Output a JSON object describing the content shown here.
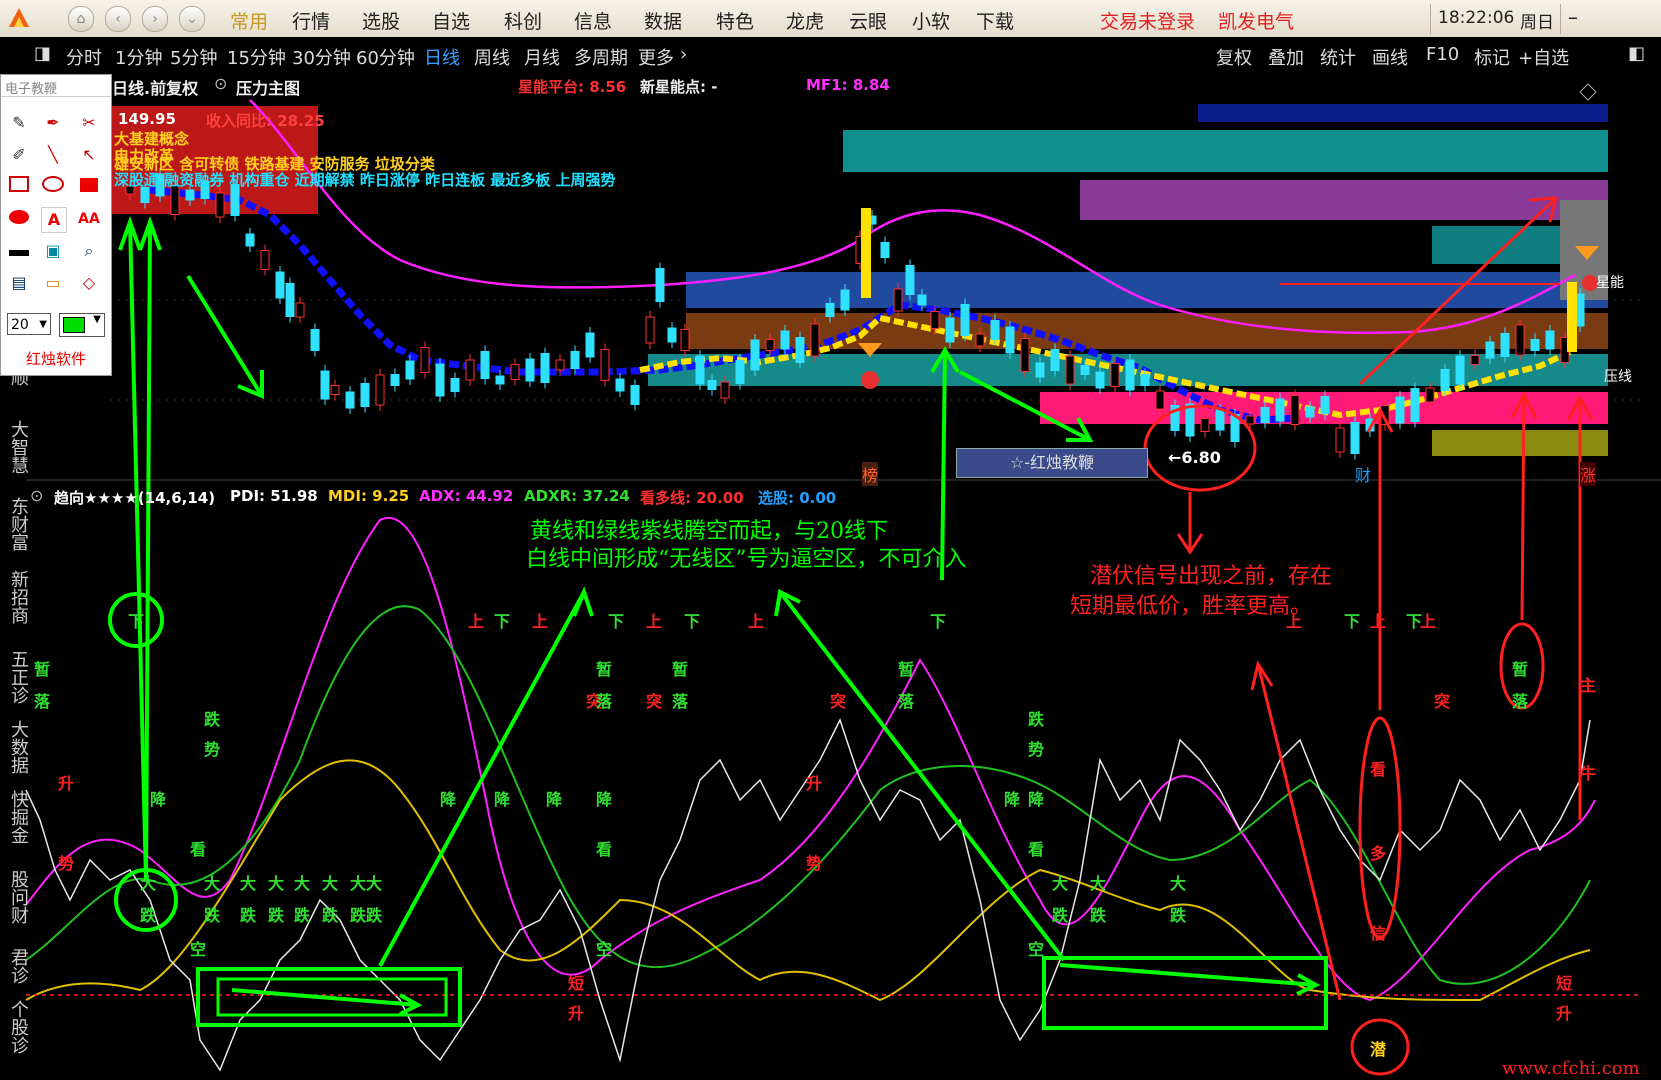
{
  "menu": {
    "items": [
      "常用",
      "行情",
      "选股",
      "自选",
      "科创",
      "信息",
      "数据",
      "特色",
      "龙虎",
      "云眼",
      "小软",
      "下载"
    ],
    "login": "交易未登录",
    "stock": "凯发电气",
    "time": "18:22:06",
    "weekday": "周日"
  },
  "periods": {
    "items": [
      "分时",
      "1分钟",
      "5分钟",
      "15分钟",
      "30分钟",
      "60分钟",
      "日线",
      "周线",
      "月线",
      "多周期",
      "更多"
    ],
    "active": "日线",
    "right": [
      "复权",
      "叠加",
      "统计",
      "画线",
      "F10",
      "标记",
      "+自选"
    ]
  },
  "chart_header": {
    "title": "日线.前复权",
    "main_fig": "压力主图",
    "star_platform_label": "星能平台: 8.56",
    "new_star_label": "新星能点: -",
    "mf1_label": "MF1: 8.84"
  },
  "overlay": {
    "price_top": "149.95",
    "revenue_yoy": "收入同比: 28.25",
    "concepts_1": "大基建概念",
    "concepts_2": "电力改革",
    "concepts_3": "雄安新区 含可转债 铁路基建 安防服务 垃圾分类",
    "concepts_4": "深股通 融资融券 机构重仓 近期解禁 昨日涨停 昨日连板 最近多板 上周强势",
    "low_price": "←6.80",
    "tutorial_btn": "☆-红烛教鞭",
    "mark_bang": "榜",
    "mark_cai": "财",
    "mark_zhang": "涨",
    "right_label_1": "星能",
    "right_label_2": "压线"
  },
  "toolbox": {
    "title": "电子教鞭",
    "size_value": "20",
    "brand": "红烛软件"
  },
  "left_nav": [
    "北顺",
    "大智慧",
    "东财富",
    "新招商",
    "五正诊",
    "大数据",
    "快掘金",
    "股问财",
    "君诊",
    "个股诊"
  ],
  "indicator": {
    "name": "趋向★★★★(14,6,14)",
    "pdi": "PDI: 51.98",
    "mdi": "MDI: 9.25",
    "adx": "ADX: 44.92",
    "adxr": "ADXR: 37.24",
    "bull_line": "看多线: 20.00",
    "select": "选股: 0.00"
  },
  "annotations": {
    "green_text_1": "黄线和绿线紫线腾空而起，与20线下",
    "green_text_2": "白线中间形成“无线区”号为逼空区，不可介入",
    "red_text_1": "潜伏信号出现之前，存在",
    "red_text_2": "短期最低价，胜率更高。"
  },
  "watermark": "www.cfchi.com",
  "colors": {
    "menu_bg": "#f0ebdf",
    "chart_bg": "#000000",
    "bull": "#ff3030",
    "bear": "#20e0ff",
    "magenta_line": "#ff20ff",
    "annotation_green": "#00ff00",
    "annotation_red": "#ff2020"
  }
}
